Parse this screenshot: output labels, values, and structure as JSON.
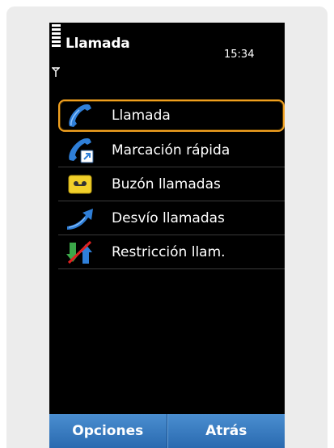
{
  "status_bar": {
    "title": "Llamada",
    "time": "15:34"
  },
  "menu": {
    "items": [
      {
        "label": "Llamada",
        "icon": "handset-icon",
        "selected": true
      },
      {
        "label": "Marcación rápida",
        "icon": "speed-dial-icon",
        "selected": false
      },
      {
        "label": "Buzón llamadas",
        "icon": "voicemail-icon",
        "selected": false
      },
      {
        "label": "Desvío llamadas",
        "icon": "call-divert-icon",
        "selected": false
      },
      {
        "label": "Restricción llam.",
        "icon": "call-barring-icon",
        "selected": false
      }
    ]
  },
  "softkeys": {
    "left": "Opciones",
    "right": "Atrás"
  },
  "colors": {
    "screen_background": "#000000",
    "highlight": "#f0a020",
    "softkey_bar": "#3a7cc0",
    "card_background": "#ececec"
  }
}
